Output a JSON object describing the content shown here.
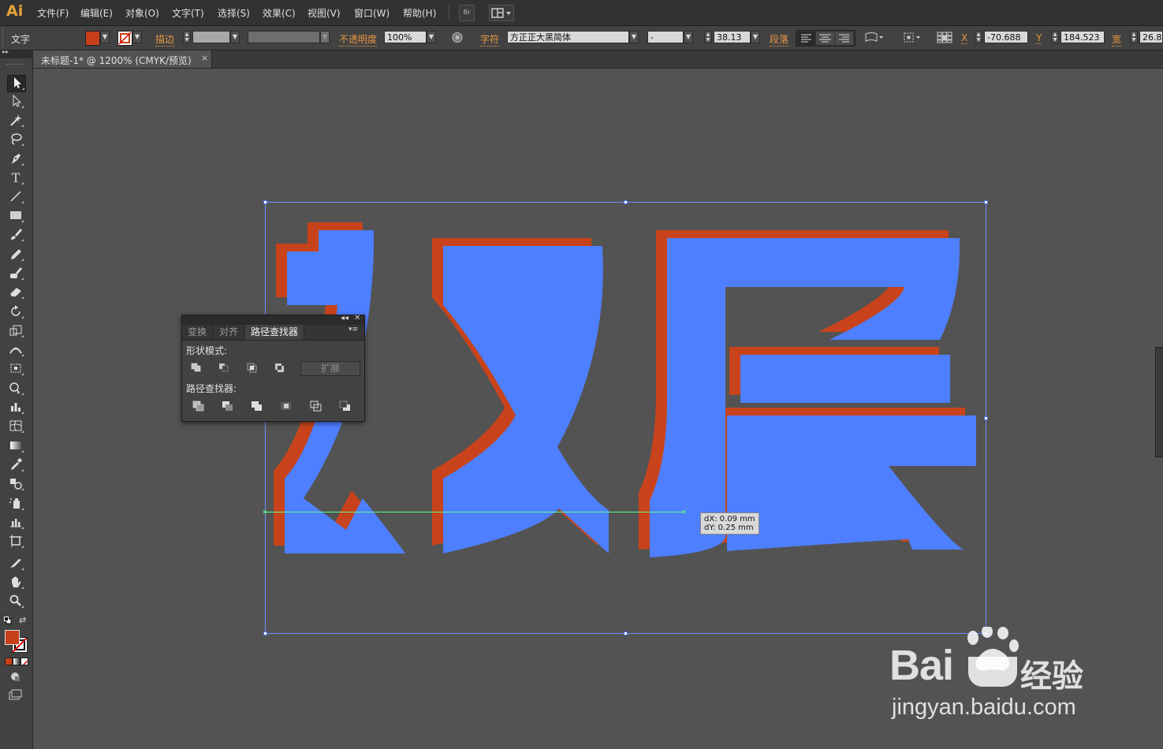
{
  "app": {
    "logo": "Ai",
    "menu": [
      "文件(F)",
      "编辑(E)",
      "对象(O)",
      "文字(T)",
      "选择(S)",
      "效果(C)",
      "视图(V)",
      "窗口(W)",
      "帮助(H)"
    ],
    "bridge_button": "Br"
  },
  "control_bar": {
    "mode_label": "文字",
    "stroke_label": "描边",
    "opacity_label": "不透明度",
    "opacity_value": "100%",
    "char_label": "字符",
    "font_family": "方正正大黑简体",
    "font_style": "-",
    "font_size": "38.13",
    "para_label": "段落",
    "x_label": "X",
    "x_value": "-70.688",
    "y_label": "Y",
    "y_value": "184.523",
    "w_label": "宽",
    "w_value": "26.8",
    "fill_color": "#c8401a",
    "stroke_color": "#ffffff"
  },
  "document": {
    "tab_title": "未标题-1* @ 1200% (CMYK/预览)",
    "close_glyph": "×"
  },
  "artwork": {
    "text": "双层",
    "front_color": "#4e7ffe",
    "shadow_color": "#c8431b",
    "selection_color": "#6c8fff"
  },
  "measure_tooltip": {
    "dx": "dX: 0.09 mm",
    "dy": "dY: 0.25 mm"
  },
  "pathfinder_panel": {
    "tabs": [
      "变换",
      "对齐",
      "路径查找器"
    ],
    "active_tab": "路径查找器",
    "shape_modes_label": "形状模式:",
    "expand_label": "扩展",
    "pathfinders_label": "路径查找器:",
    "collapse_glyph": "◂◂",
    "close_glyph": "✕",
    "menu_glyph": "▾≡"
  },
  "watermark": {
    "brand": "Bai",
    "brand_cn": "经验",
    "url": "jingyan.baidu.com"
  }
}
